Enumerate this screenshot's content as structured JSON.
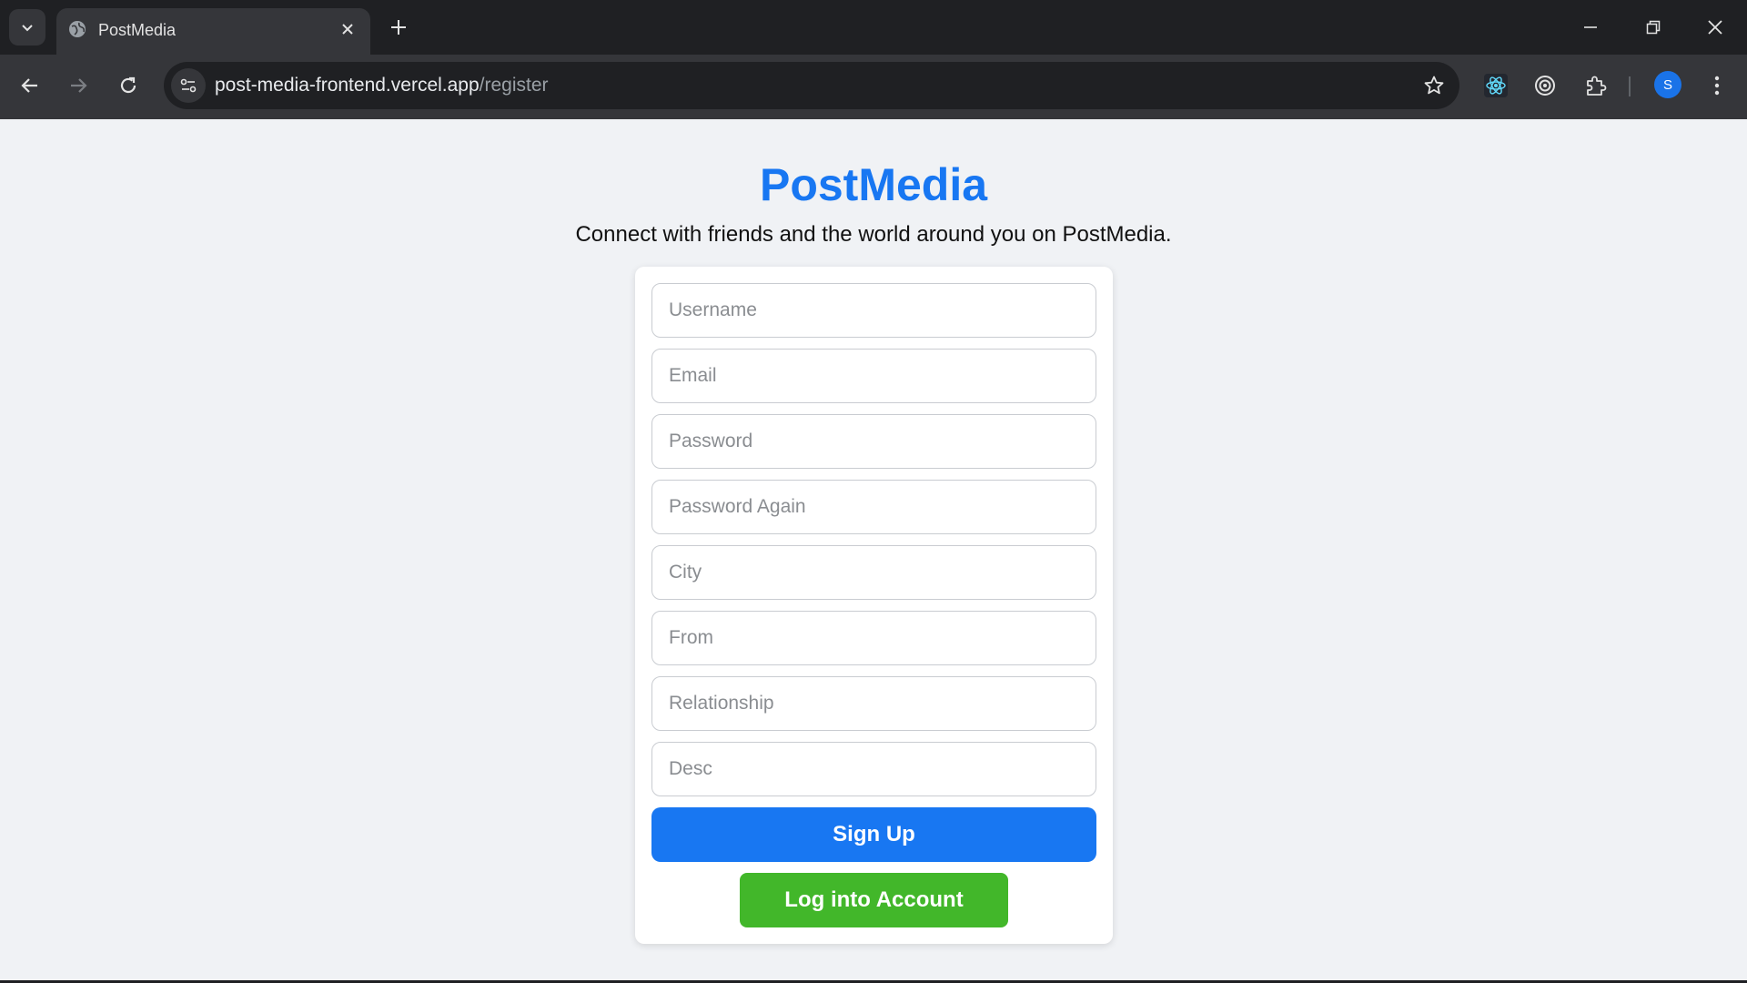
{
  "browser": {
    "tab": {
      "title": "PostMedia",
      "favicon": "globe-icon"
    },
    "address": {
      "host": "post-media-frontend.vercel.app",
      "path": "/register"
    },
    "profile_initial": "S",
    "extensions": [
      "react-devtools-icon",
      "target-icon",
      "puzzle-icon"
    ]
  },
  "header": {
    "logo": "PostMedia",
    "tagline": "Connect with friends and the world around you on PostMedia."
  },
  "form": {
    "fields": {
      "username": {
        "placeholder": "Username",
        "value": ""
      },
      "email": {
        "placeholder": "Email",
        "value": ""
      },
      "password": {
        "placeholder": "Password",
        "value": ""
      },
      "password_again": {
        "placeholder": "Password Again",
        "value": ""
      },
      "city": {
        "placeholder": "City",
        "value": ""
      },
      "from": {
        "placeholder": "From",
        "value": ""
      },
      "relationship": {
        "placeholder": "Relationship",
        "value": ""
      },
      "desc": {
        "placeholder": "Desc",
        "value": ""
      }
    },
    "signup_label": "Sign Up",
    "login_label": "Log into Account"
  },
  "colors": {
    "brand": "#1877f2",
    "login_button": "#42b72a",
    "page_background": "#f0f2f5"
  }
}
